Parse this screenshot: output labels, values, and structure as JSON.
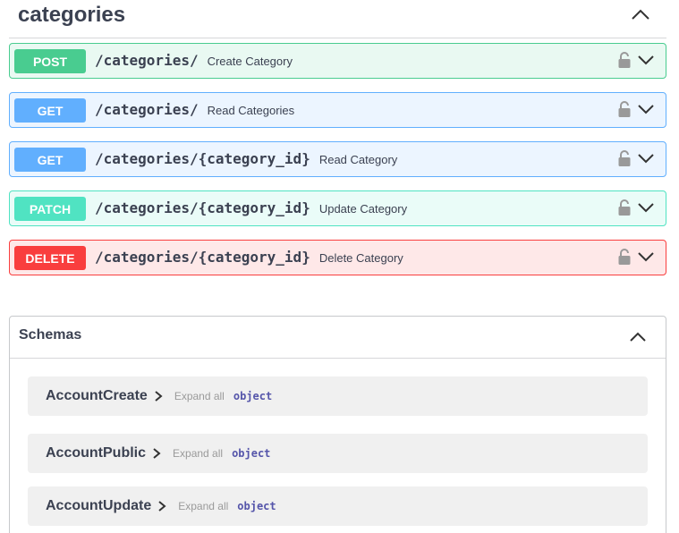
{
  "tag": {
    "title": "categories",
    "toggle_icon": "chevron-up-icon"
  },
  "operations": [
    {
      "method": "POST",
      "path": "/categories/",
      "summary": "Create Category",
      "color": "#49cc90"
    },
    {
      "method": "GET",
      "path": "/categories/",
      "summary": "Read Categories",
      "color": "#61affe"
    },
    {
      "method": "GET",
      "path": "/categories/{category_id}",
      "summary": "Read Category",
      "color": "#61affe"
    },
    {
      "method": "PATCH",
      "path": "/categories/{category_id}",
      "summary": "Update Category",
      "color": "#50e3c2"
    },
    {
      "method": "DELETE",
      "path": "/categories/{category_id}",
      "summary": "Delete Category",
      "color": "#f93e3e"
    }
  ],
  "schemas": {
    "title": "Schemas",
    "models": [
      {
        "name": "AccountCreate",
        "expand": "Expand all",
        "type": "object"
      },
      {
        "name": "AccountPublic",
        "expand": "Expand all",
        "type": "object"
      },
      {
        "name": "AccountUpdate",
        "expand": "Expand all",
        "type": "object"
      }
    ]
  }
}
